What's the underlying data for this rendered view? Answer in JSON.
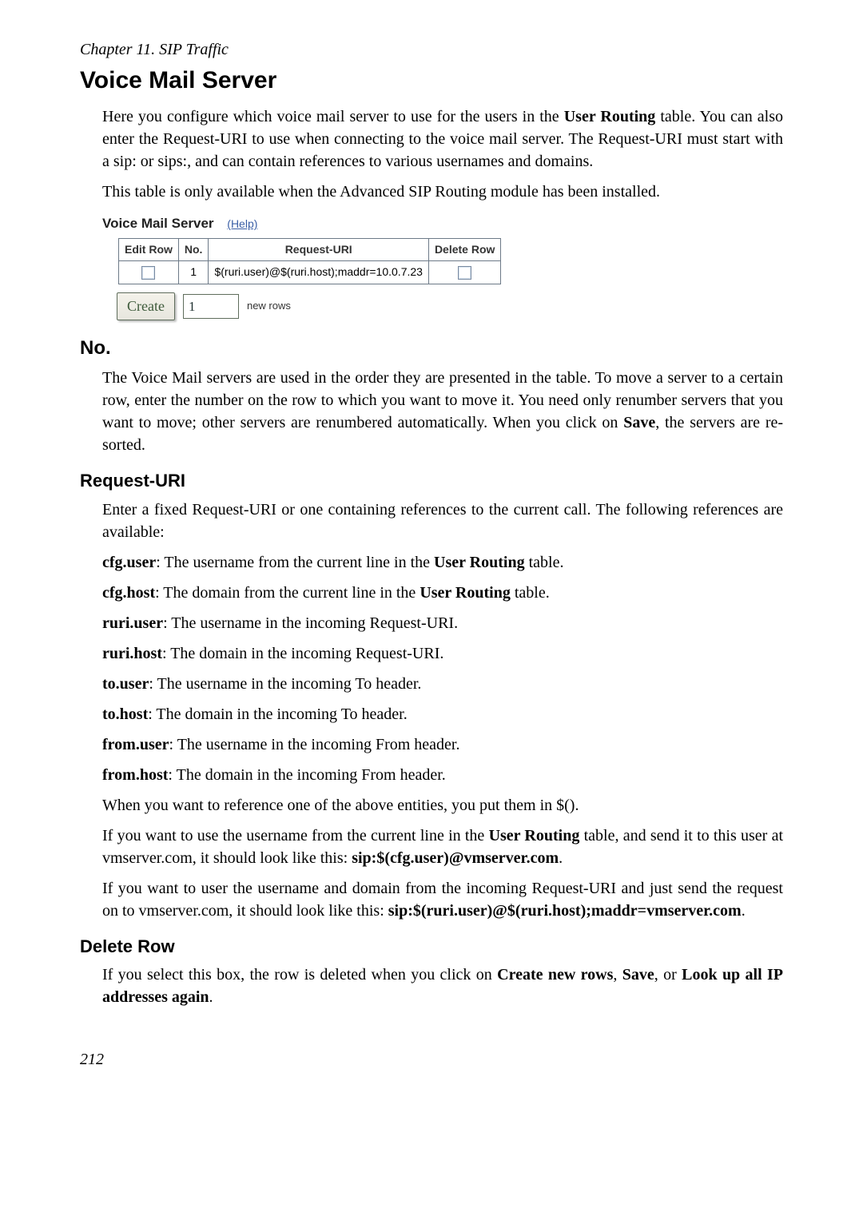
{
  "chapter_ref": "Chapter 11. SIP Traffic",
  "main_heading": "Voice Mail Server",
  "intro_p1_pre": "Here you configure which voice mail server to use for the users in the ",
  "intro_p1_bold": "User Routing",
  "intro_p1_post": " table. You can also enter the Request-URI to use when connecting to the voice mail server. The Request-URI must start with a sip: or sips:, and can contain references to various usernames and domains.",
  "intro_p2": "This table is only available when the Advanced SIP Routing module has been installed.",
  "panel": {
    "title": "Voice Mail Server",
    "help": "(Help)",
    "headers": {
      "edit": "Edit Row",
      "no": "No.",
      "req": "Request-URI",
      "del": "Delete Row"
    },
    "row": {
      "no": "1",
      "req": "$(ruri.user)@$(ruri.host);maddr=10.0.7.23"
    },
    "create_btn": "Create",
    "create_input": "1",
    "new_rows": "new rows"
  },
  "no_heading": "No.",
  "no_text_a": "The Voice Mail servers are used in the order they are presented in the table. To move a server to a certain row, enter the number on the row to which you want to move it. You need only renumber servers that you want to move; other servers are renumbered automatically. When you click on ",
  "no_text_bold": "Save",
  "no_text_b": ", the servers are re-sorted.",
  "request_uri_heading": "Request-URI",
  "req_intro": "Enter a fixed Request-URI or one containing references to the current call. The following references are available:",
  "refs": {
    "cfg_user_label": "cfg.user",
    "cfg_user_text": ": The username from the current line in the ",
    "cfg_user_bold": "User Routing",
    "cfg_user_tail": " table.",
    "cfg_host_label": "cfg.host",
    "cfg_host_text": ": The domain from the current line in the ",
    "cfg_host_bold": "User Routing",
    "cfg_host_tail": " table.",
    "ruri_user_label": "ruri.user",
    "ruri_user_text": ": The username in the incoming Request-URI.",
    "ruri_host_label": "ruri.host",
    "ruri_host_text": ": The domain in the incoming Request-URI.",
    "to_user_label": "to.user",
    "to_user_text": ": The username in the incoming To header.",
    "to_host_label": "to.host",
    "to_host_text": ": The domain in the incoming To header.",
    "from_user_label": "from.user",
    "from_user_text": ": The username in the incoming From header.",
    "from_host_label": "from.host",
    "from_host_text": ": The domain in the incoming From header."
  },
  "when_ref": "When you want to reference one of the above entities, you put them in $().",
  "example1_a": "If you want to use the username from the current line in the ",
  "example1_bold1": "User Routing",
  "example1_b": " table, and send it to this user at vmserver.com, it should look like this: ",
  "example1_bold2": "sip:$(cfg.user)@vmserver.com",
  "example1_c": ".",
  "example2_a": "If you want to user the username and domain from the incoming Request-URI and just send the request on to vmserver.com, it should look like this: ",
  "example2_bold": "sip:$(ruri.user)@$(ruri.host);maddr=vmserver.com",
  "example2_b": ".",
  "delete_row_heading": "Delete Row",
  "delete_a": "If you select this box, the row is deleted when you click on ",
  "delete_bold1": "Create new rows",
  "delete_sep1": ", ",
  "delete_bold2": "Save",
  "delete_sep2": ", or ",
  "delete_bold3": "Look up all IP addresses again",
  "delete_b": ".",
  "page_number": "212"
}
